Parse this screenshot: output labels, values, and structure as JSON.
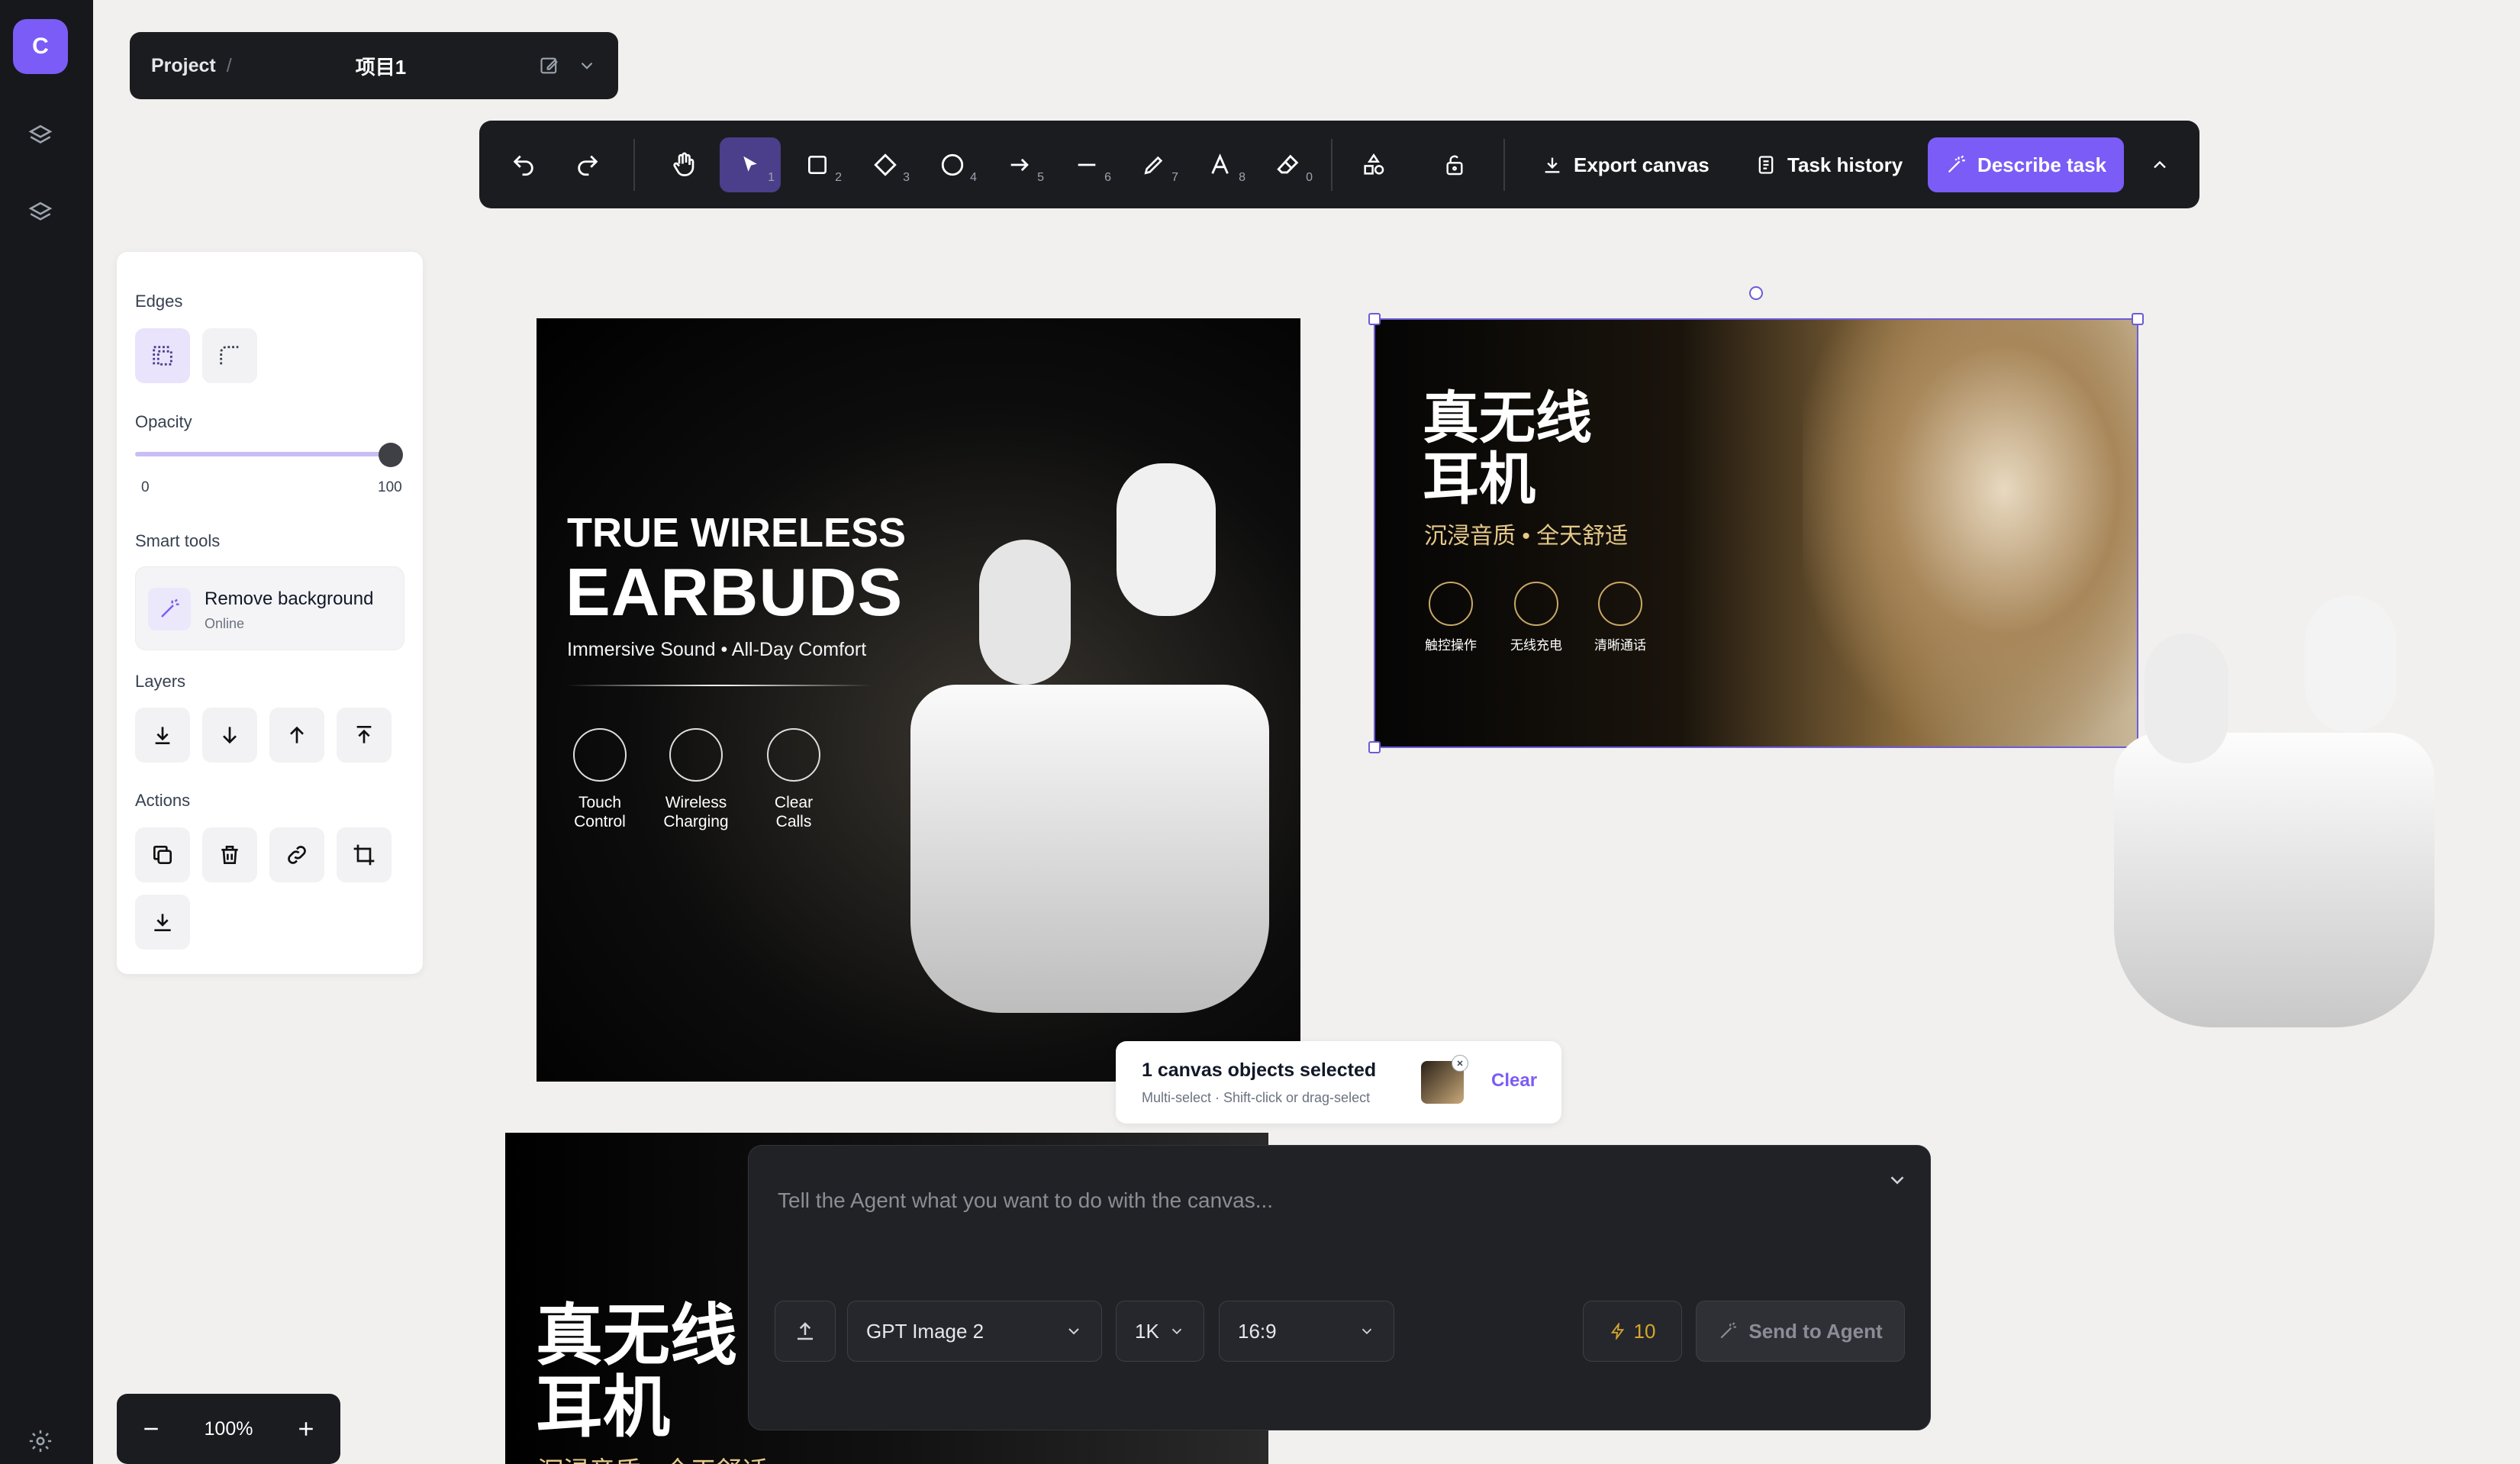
{
  "rail": {
    "logo_letter": "C"
  },
  "project": {
    "label": "Project",
    "separator": "/",
    "name": "项目1"
  },
  "toolbar": {
    "tool_numbers": [
      "1",
      "2",
      "3",
      "4",
      "5",
      "6",
      "7",
      "8",
      "0"
    ],
    "export_label": "Export canvas",
    "history_label": "Task history",
    "describe_label": "Describe task"
  },
  "panel": {
    "edges_label": "Edges",
    "opacity_label": "Opacity",
    "opacity_min": "0",
    "opacity_max": "100",
    "opacity_value": 100,
    "smart_tools_label": "Smart tools",
    "remove_bg_title": "Remove background",
    "remove_bg_sub": "Online",
    "layers_label": "Layers",
    "actions_label": "Actions"
  },
  "canvas": {
    "img1": {
      "line1": "TRUE WIRELESS",
      "line2": "EARBUDS",
      "tagline": "Immersive Sound • All-Day Comfort",
      "features": [
        {
          "l1": "Touch",
          "l2": "Control"
        },
        {
          "l1": "Wireless",
          "l2": "Charging"
        },
        {
          "l1": "Clear",
          "l2": "Calls"
        }
      ]
    },
    "img2": {
      "line1": "真无线",
      "line2": "耳机",
      "tagline": "沉浸音质 • 全天舒适",
      "features": [
        "触控操作",
        "无线充电",
        "清晰通话"
      ]
    },
    "img4": {
      "line1": "真无线",
      "line2": "耳机",
      "tagline": "沉浸音质 • 全天舒适"
    }
  },
  "selection": {
    "title": "1 canvas objects selected",
    "hint": "Multi-select · Shift-click or drag-select",
    "clear_label": "Clear"
  },
  "agent": {
    "placeholder": "Tell the Agent what you want to do with the canvas...",
    "model": "GPT Image 2",
    "resolution": "1K",
    "aspect": "16:9",
    "credits": "10",
    "send_label": "Send to Agent"
  },
  "zoom": {
    "level": "100%"
  },
  "colors": {
    "accent": "#7b5cf6",
    "dark": "#1b1c20",
    "canvas_bg": "#f1f0ee",
    "credit": "#d4a72c"
  }
}
